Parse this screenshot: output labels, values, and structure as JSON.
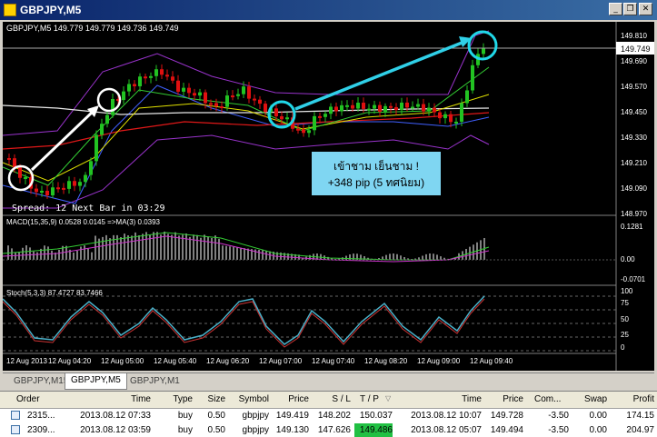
{
  "window": {
    "title": "GBPJPY,M5",
    "min_glyph": "_",
    "restore_glyph": "❐",
    "close_glyph": "✕"
  },
  "chart": {
    "header": "GBPJPY,M5  149.779 149.779 149.736 149.749",
    "spread_text": "Spread: 12  Next Bar in 03:29",
    "price_labels": [
      "149.810",
      "149.690",
      "149.570",
      "149.450",
      "149.330",
      "149.210",
      "149.090",
      "148.970"
    ],
    "current_price": "149.749",
    "annotation": {
      "line1": "เข้าชาม เย็นชาม !",
      "line2": "+348 pip (5 ทศนิยม)"
    },
    "macd_header": "MACD(15,35,9) 0.0528 0.0145 =>MA(3) 0.0393",
    "macd_labels": [
      "0.1281",
      "0.00",
      "-0.0701"
    ],
    "stoch_header": "Stoch(5,3,3) 87.4727 83.7466",
    "stoch_labels": [
      "100",
      "75",
      "50",
      "25",
      "0"
    ],
    "time_labels": [
      "12 Aug 2013",
      "12 Aug 04:20",
      "12 Aug 05:00",
      "12 Aug 05:40",
      "12 Aug 06:20",
      "12 Aug 07:00",
      "12 Aug 07:40",
      "12 Aug 08:20",
      "12 Aug 09:00",
      "12 Aug 09:40"
    ]
  },
  "tabs": [
    "GBPJPY,M15",
    "GBPJPY,M5",
    "GBPJPY,M1"
  ],
  "terminal": {
    "columns": [
      "Order",
      "Time",
      "Type",
      "Size",
      "Symbol",
      "Price",
      "S / L",
      "T / P",
      "Time",
      "Price",
      "Com...",
      "Swap",
      "Profit"
    ],
    "rows": [
      {
        "order": "2315...",
        "open_time": "2013.08.12 07:33",
        "type": "buy",
        "size": "0.50",
        "symbol": "gbpjpy",
        "price": "149.419",
        "sl": "148.202",
        "tp": "150.037",
        "close_time": "2013.08.12 10:07",
        "close_price": "149.728",
        "commission": "-3.50",
        "swap": "0.00",
        "profit": "174.15"
      },
      {
        "order": "2309...",
        "open_time": "2013.08.12 03:59",
        "type": "buy",
        "size": "0.50",
        "symbol": "gbpjpy",
        "price": "149.130",
        "sl": "147.626",
        "tp": "149.486",
        "close_time": "2013.08.12 05:07",
        "close_price": "149.494",
        "commission": "-3.50",
        "swap": "0.00",
        "profit": "204.97"
      }
    ]
  },
  "colors": {
    "bull": "#22c322",
    "bear": "#e01010",
    "ma_white": "#e8e8e8",
    "ma_red": "#e01818",
    "ma_yellow": "#e0e000",
    "ma_green": "#33cc33",
    "band_purple": "#9933cc",
    "stoch_cyan": "#4ab0c8",
    "annotation_bg": "#7fd6f2",
    "circle_cyan": "#20d8e8",
    "arrow_cyan": "#30d0e8"
  }
}
